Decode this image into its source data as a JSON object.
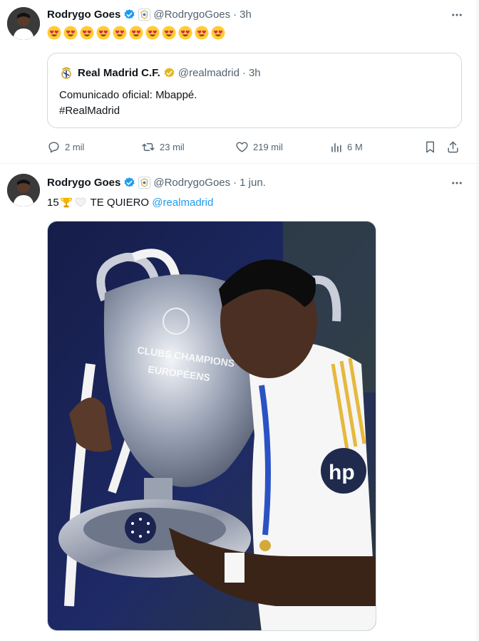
{
  "tweets": [
    {
      "author": {
        "name": "Rodrygo Goes",
        "handle": "@RodrygoGoes",
        "time": "3h",
        "verified": true
      },
      "text_emoji": [
        "heart-eyes",
        "heart-eyes",
        "heart-eyes",
        "heart-eyes",
        "heart-eyes",
        "heart-eyes",
        "heart-eyes",
        "heart-eyes",
        "heart-eyes",
        "heart-eyes",
        "heart-eyes"
      ],
      "quote": {
        "author": {
          "name": "Real Madrid C.F.",
          "handle": "@realmadrid",
          "time": "3h"
        },
        "line1": "Comunicado oficial: Mbappé.",
        "line2": "#RealMadrid"
      },
      "actions": {
        "replies": "2 mil",
        "retweets": "23 mil",
        "likes": "219 mil",
        "views": "6 M"
      }
    },
    {
      "author": {
        "name": "Rodrygo Goes",
        "handle": "@RodrygoGoes",
        "time": "1 jun.",
        "verified": true
      },
      "text": {
        "count": "15",
        "body": " TE QUIERO ",
        "mention": "@realmadrid"
      },
      "photo": {
        "trophy_text_1": "CLUBS CHAMPIONS",
        "trophy_text_2": "EUROPÉENS",
        "sponsor": "hp"
      }
    }
  ],
  "colors": {
    "accent": "#1d9bf0",
    "secondary_text": "#536471",
    "gold_badge": "#e2b719",
    "border": "#cfd9de"
  },
  "icons": {
    "dot": "·",
    "more": "more-icon"
  }
}
